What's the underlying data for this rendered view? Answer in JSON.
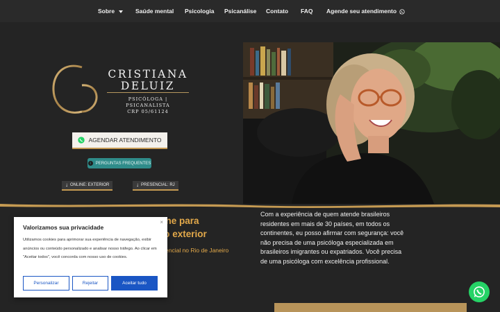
{
  "nav": {
    "items": [
      {
        "label": "Sobre"
      },
      {
        "label": "Saúde mental"
      },
      {
        "label": "Psicologia"
      },
      {
        "label": "Psicanálise"
      },
      {
        "label": "Contato"
      },
      {
        "label": "FAQ"
      },
      {
        "label": "Agende seu atendimento"
      }
    ]
  },
  "logo": {
    "name_line1": "CRISTIANA",
    "name_line2": "DELUIZ",
    "subtitle": "PSICÓLOGA | PSICANALISTA",
    "crp": "CRP 05/61124"
  },
  "hero": {
    "agendar_label": "AGENDAR ATENDIMENTO",
    "faq_label": "PERGUNTAS FREQUENTES",
    "online_label": "ONLINE: EXTERIOR",
    "presencial_label": "PRESENCIAL: RJ"
  },
  "bottom": {
    "heading_line1": "to online para",
    "heading_line2": "no exterior",
    "subheading": "encial no Rio de Janeiro",
    "paragraph": "Com a experiência de quem atende brasileiros residentes em mais de 30 países, em todos os continentes, eu posso afirmar com segurança: você não precisa de uma psicóloga especializada em brasileiros imigrantes ou expatriados. Você precisa de uma psicóloga com excelência profissional."
  },
  "cookie": {
    "close": "×",
    "title": "Valorizamos sua privacidade",
    "text": "Utilizamos cookies para aprimorar sua experiência de navegação, exibir anúncios ou conteúdo personalizado e analisar nosso tráfego. Ao clicar em \"Aceitar todos\", você concorda com nosso uso de cookies.",
    "customize_label": "Personalizar",
    "reject_label": "Rejeitar",
    "accept_label": "Aceitar tudo"
  },
  "colors": {
    "accent_gold": "#c59a52",
    "heading_gold": "#e3a94a",
    "teal": "#2f8c8a",
    "cookie_blue": "#1a56c4",
    "whatsapp": "#25d366"
  },
  "icons": [
    "chevron-down-icon",
    "whatsapp-icon",
    "info-icon",
    "arrow-down-icon",
    "close-icon"
  ]
}
